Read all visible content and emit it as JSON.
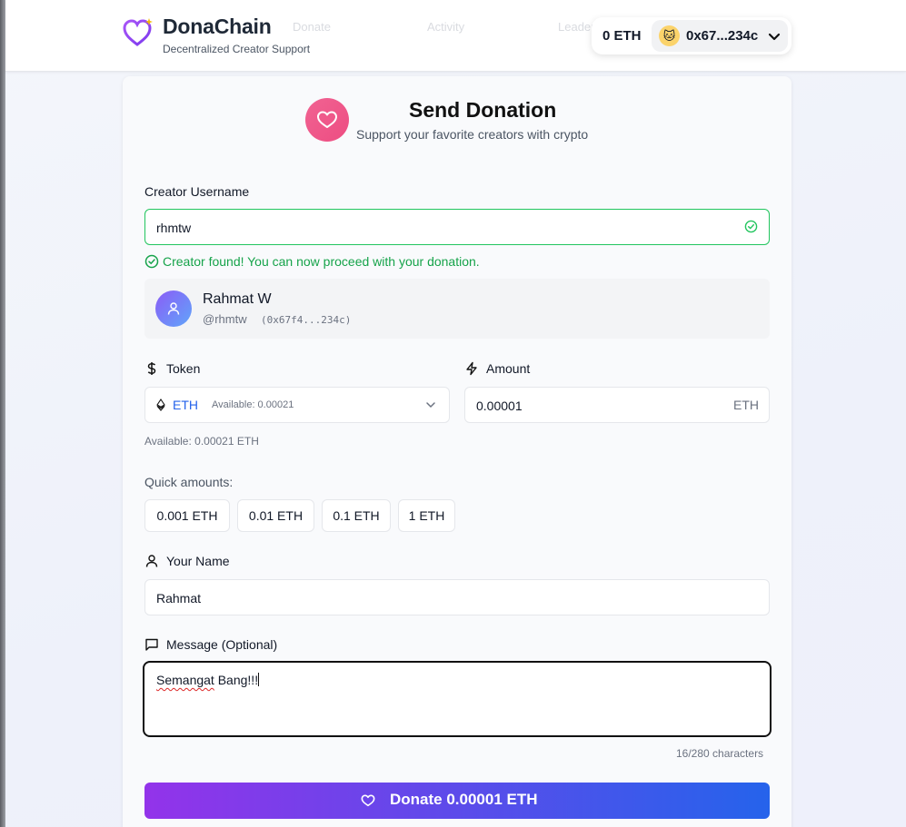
{
  "header": {
    "app_name": "DonaChain",
    "tagline": "Decentralized Creator Support",
    "nav_faded": [
      "Donate",
      "Activity",
      "Leaderboard"
    ],
    "wallet": {
      "balance": "0 ETH",
      "address": "0x67...234c",
      "avatar_emoji": "🐱"
    }
  },
  "form": {
    "title": "Send Donation",
    "subtitle": "Support your favorite creators with crypto",
    "creator_username_label": "Creator Username",
    "creator_username_value": "rhmtw",
    "creator_found_message": "Creator found! You can now proceed with your donation.",
    "creator": {
      "name": "Rahmat W",
      "handle": "@rhmtw",
      "address": "(0x67f4...234c)"
    },
    "token_label": "Token",
    "token_value": "ETH",
    "token_available": "Available: 0.00021",
    "token_available_note": "Available: 0.00021 ETH",
    "amount_label": "Amount",
    "amount_value": "0.00001",
    "amount_unit": "ETH",
    "quick_amounts_label": "Quick amounts:",
    "quick_amounts": [
      "0.001 ETH",
      "0.01 ETH",
      "0.1 ETH",
      "1 ETH"
    ],
    "name_label": "Your Name",
    "name_value": "Rahmat",
    "message_label": "Message (Optional)",
    "message_value_word1": "Semangat",
    "message_value_rest": " Bang!!!",
    "char_count": "16/280 characters",
    "donate_button": "Donate 0.00001 ETH"
  },
  "colors": {
    "accent_purple": "#9333ea",
    "accent_blue": "#2563eb",
    "success_green": "#16a34a",
    "heart_pink": "#ee4d82"
  }
}
